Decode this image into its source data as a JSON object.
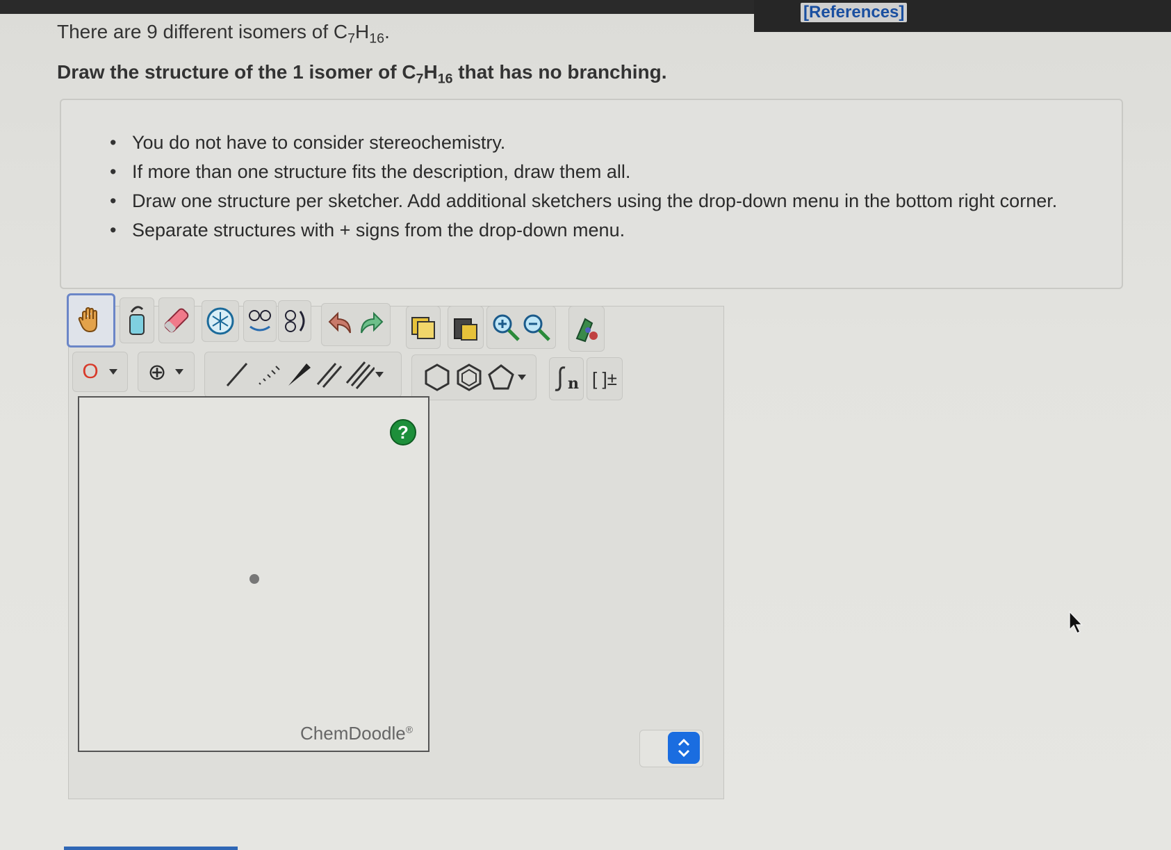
{
  "header": {
    "references_label": "[References]"
  },
  "question": {
    "intro_prefix": "There are 9 different isomers of C",
    "intro_sub1": "7",
    "intro_mid": "H",
    "intro_sub2": "16",
    "intro_suffix": ".",
    "prompt_prefix": "Draw the structure of the 1 isomer of C",
    "prompt_sub1": "7",
    "prompt_mid": "H",
    "prompt_sub2": "16",
    "prompt_suffix": " that has no branching."
  },
  "instructions": [
    "You do not have to consider stereochemistry.",
    "If more than one structure fits the description, draw them all.",
    "Draw one structure per sketcher. Add additional sketchers using the drop-down menu in the bottom right corner.",
    "Separate structures with + signs from the drop-down menu."
  ],
  "toolbar": {
    "atom_label": "O",
    "charge_label": "⊕",
    "bracket_label": "[ ]±",
    "sn_label": "n",
    "icons": [
      "hand-icon",
      "lasso-icon",
      "eraser-icon",
      "ring-template-icon",
      "flip-icon",
      "rotate-icon",
      "undo-icon",
      "redo-icon",
      "copy-icon",
      "paste-icon",
      "zoom-in-icon",
      "zoom-out-icon",
      "clean-icon"
    ]
  },
  "canvas": {
    "help_label": "?",
    "brand": "ChemDoodle",
    "brand_mark": "®"
  },
  "colors": {
    "accent": "#1a6de0",
    "help": "#1d8f3a",
    "references": "#1a4fa0"
  }
}
